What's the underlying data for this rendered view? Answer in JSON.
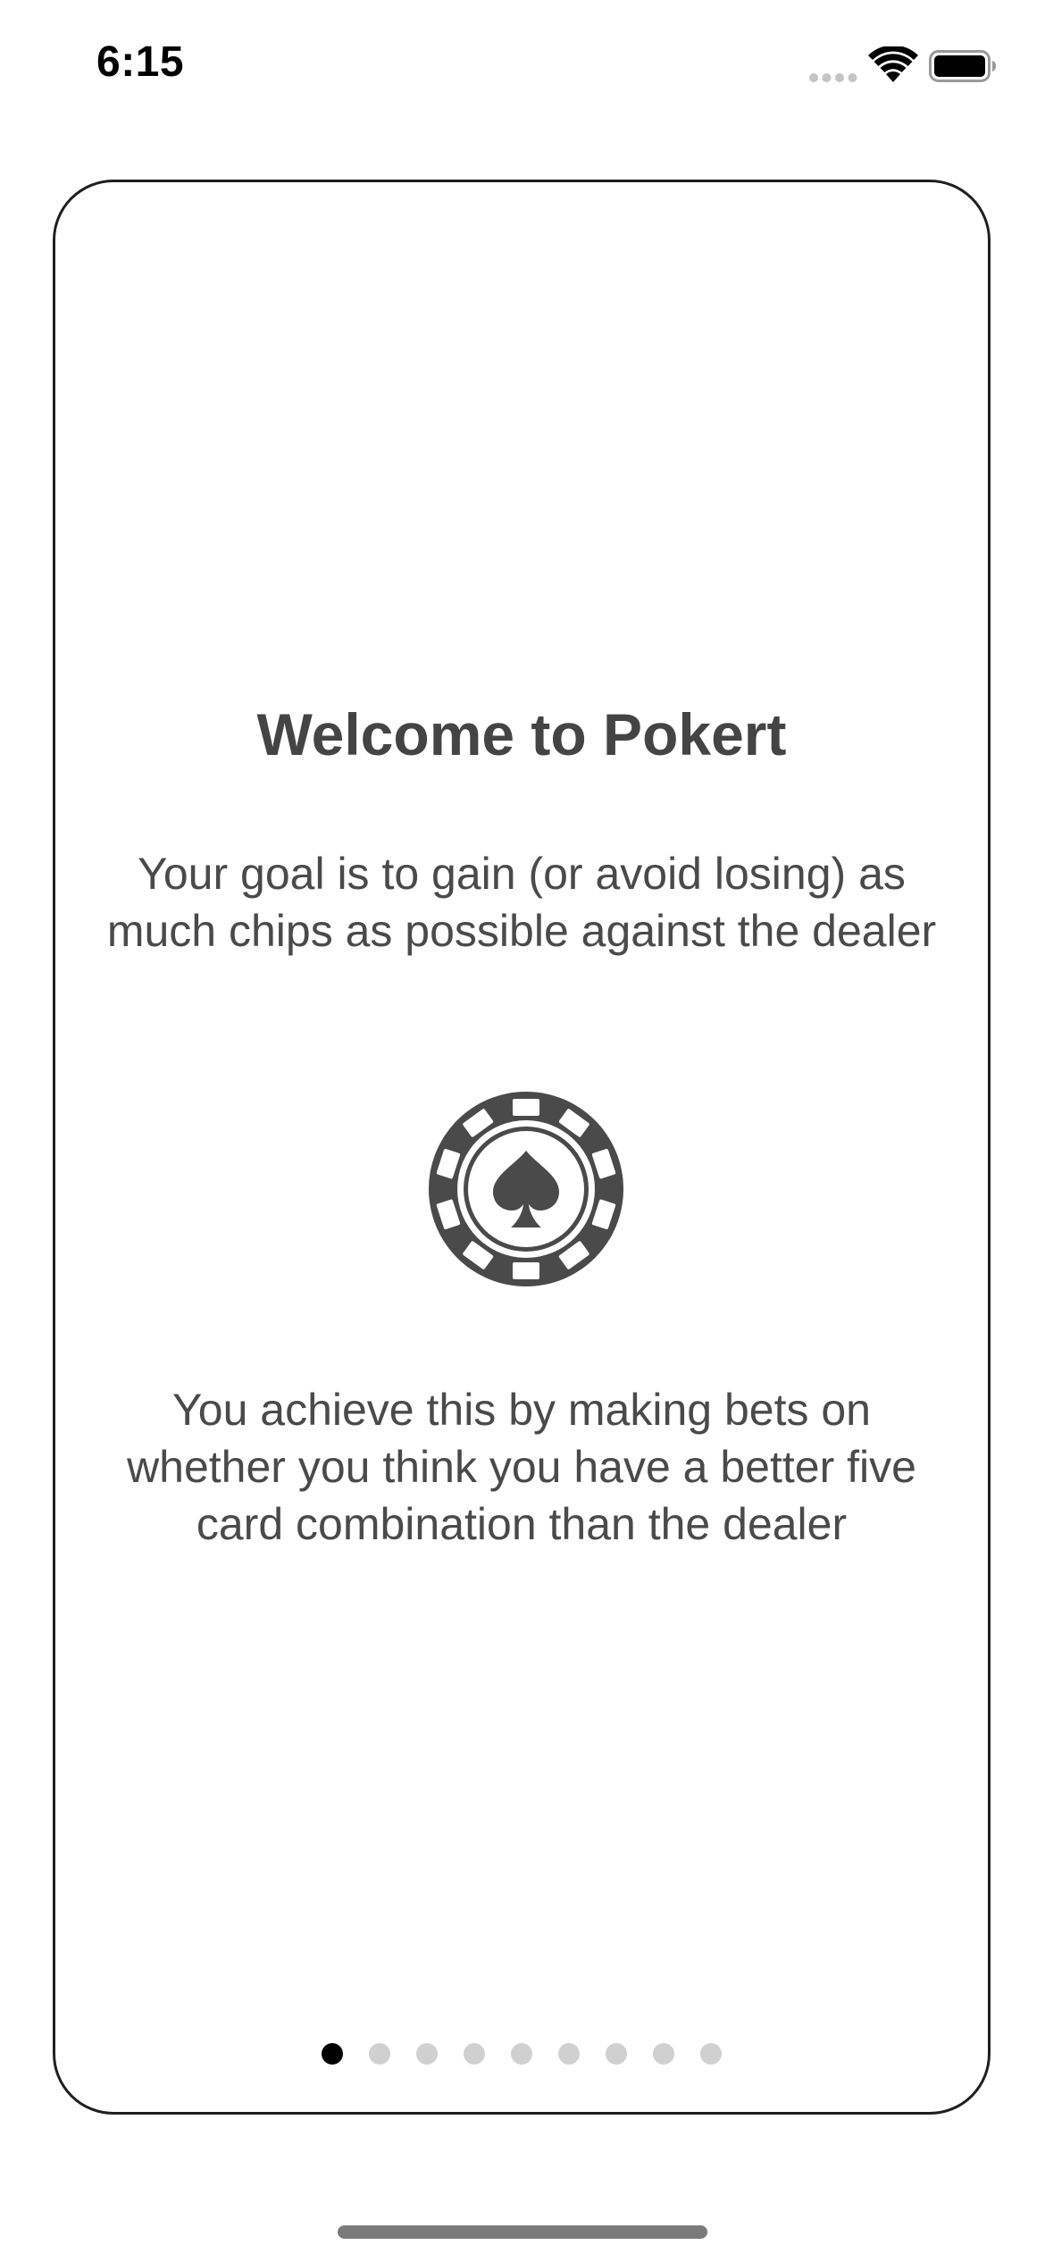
{
  "status_bar": {
    "time": "6:15",
    "icons": [
      "signal-icon",
      "wifi-icon",
      "battery-icon"
    ]
  },
  "onboarding": {
    "title": "Welcome to Pokert",
    "goal_text": "Your goal is to gain (or avoid losing) as much chips as possible against the dealer",
    "icon": "poker-chip-spade-icon",
    "achieve_text": "You achieve this by making bets on whether you think you have a better five card combination than the dealer",
    "pager": {
      "page_count": 9,
      "current_page": 1
    }
  },
  "colors": {
    "text": "#4a4a4a",
    "card_border": "#1f1f1f",
    "dot_active": "#000000",
    "dot_inactive": "#d0d0d0",
    "chip": "#4a4a4a"
  }
}
